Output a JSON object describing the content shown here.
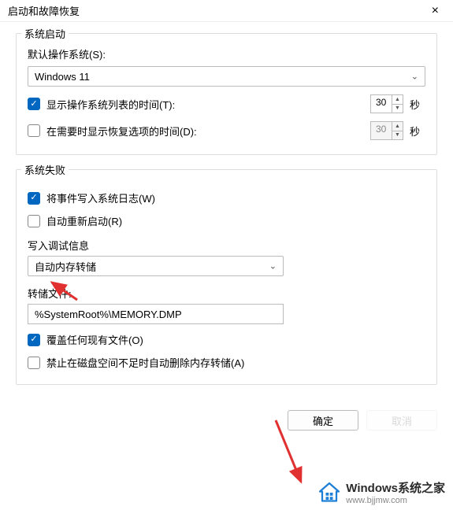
{
  "window": {
    "title": "启动和故障恢复",
    "close": "×"
  },
  "startup": {
    "legend": "系统启动",
    "defaultOsLabel": "默认操作系统(S):",
    "defaultOs": "Windows 11",
    "showOsList": {
      "label": "显示操作系统列表的时间(T):",
      "value": "30",
      "unit": "秒",
      "checked": true
    },
    "showRecovery": {
      "label": "在需要时显示恢复选项的时间(D):",
      "value": "30",
      "unit": "秒",
      "checked": false
    }
  },
  "failure": {
    "legend": "系统失败",
    "writeEvent": {
      "label": "将事件写入系统日志(W)",
      "checked": true
    },
    "autoRestart": {
      "label": "自动重新启动(R)",
      "checked": false
    },
    "debugInfoLabel": "写入调试信息",
    "dumpType": "自动内存转储",
    "dumpFileLabel": "转储文件:",
    "dumpFile": "%SystemRoot%\\MEMORY.DMP",
    "overwrite": {
      "label": "覆盖任何现有文件(O)",
      "checked": true
    },
    "noDeleteLowSpace": {
      "label": "禁止在磁盘空间不足时自动删除内存转储(A)",
      "checked": false
    }
  },
  "buttons": {
    "ok": "确定",
    "cancel": "取消"
  },
  "watermark": {
    "title": "Windows系统之家",
    "url": "www.bjjmw.com"
  }
}
